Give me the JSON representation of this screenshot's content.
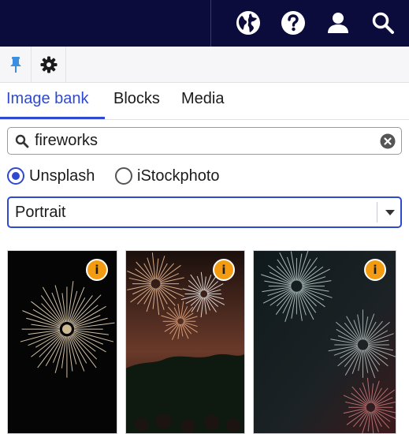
{
  "topbar": {
    "icons": [
      "globe-icon",
      "help-icon",
      "user-icon",
      "search-icon"
    ],
    "background": "#0b0b3c"
  },
  "toolstrip": {
    "icons": [
      "pin-icon",
      "gear-icon"
    ],
    "pin_color": "#3c8fe0"
  },
  "tabs": [
    {
      "label": "Image bank",
      "active": true
    },
    {
      "label": "Blocks",
      "active": false
    },
    {
      "label": "Media",
      "active": false
    }
  ],
  "accent": "#2f49d1",
  "search": {
    "value": "fireworks",
    "placeholder": ""
  },
  "sources": {
    "options": [
      "Unsplash",
      "iStockphoto"
    ],
    "selected": "Unsplash"
  },
  "orientation": {
    "selected": "Portrait"
  },
  "results": [
    {
      "subject": "fireworks",
      "info_icon": "info-icon"
    },
    {
      "subject": "fireworks",
      "info_icon": "info-icon"
    },
    {
      "subject": "fireworks",
      "info_icon": "info-icon"
    }
  ],
  "info_badge": {
    "glyph": "i",
    "color": "#f39c12"
  }
}
